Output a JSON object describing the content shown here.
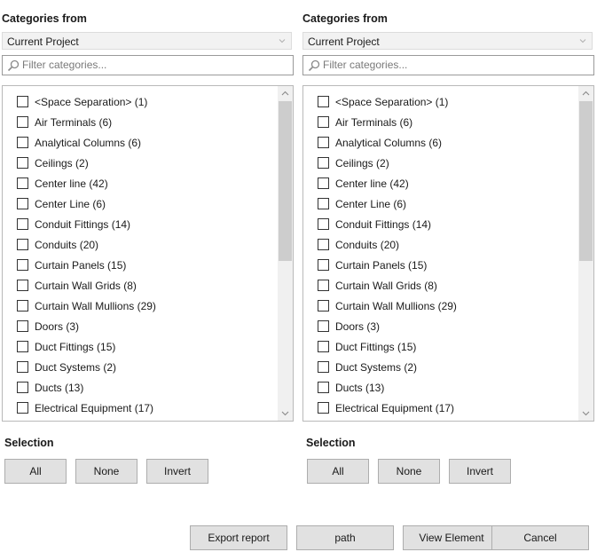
{
  "panels": [
    {
      "heading": "Categories from",
      "combo_value": "Current Project",
      "filter_placeholder": "Filter categories...",
      "items": [
        "<Space Separation> (1)",
        "Air Terminals (6)",
        "Analytical Columns (6)",
        "Ceilings (2)",
        "Center line (42)",
        "Center Line (6)",
        "Conduit Fittings (14)",
        "Conduits (20)",
        "Curtain Panels (15)",
        "Curtain Wall Grids (8)",
        "Curtain Wall Mullions (29)",
        "Doors (3)",
        "Duct Fittings (15)",
        "Duct Systems (2)",
        "Ducts (13)",
        "Electrical Equipment (17)"
      ],
      "selection_heading": "Selection",
      "buttons": {
        "all": "All",
        "none": "None",
        "invert": "Invert"
      }
    },
    {
      "heading": "Categories from",
      "combo_value": "Current Project",
      "filter_placeholder": "Filter categories...",
      "items": [
        "<Space Separation> (1)",
        "Air Terminals (6)",
        "Analytical Columns (6)",
        "Ceilings (2)",
        "Center line (42)",
        "Center Line (6)",
        "Conduit Fittings (14)",
        "Conduits (20)",
        "Curtain Panels (15)",
        "Curtain Wall Grids (8)",
        "Curtain Wall Mullions (29)",
        "Doors (3)",
        "Duct Fittings (15)",
        "Duct Systems (2)",
        "Ducts (13)",
        "Electrical Equipment (17)"
      ],
      "selection_heading": "Selection",
      "buttons": {
        "all": "All",
        "none": "None",
        "invert": "Invert"
      }
    }
  ],
  "footer": {
    "export_report": "Export report",
    "path": "path",
    "view_element": "View Element",
    "cancel": "Cancel"
  },
  "icons": {
    "combo_arrow": "chevron-down-icon",
    "filter": "search-icon",
    "scroll_up": "chevron-up-icon",
    "scroll_down": "chevron-down-icon"
  },
  "colors": {
    "button_bg": "#e1e1e1",
    "button_border": "#adadad",
    "combo_bg": "#f2f2f2",
    "scroll_thumb": "#cdcdcd"
  }
}
